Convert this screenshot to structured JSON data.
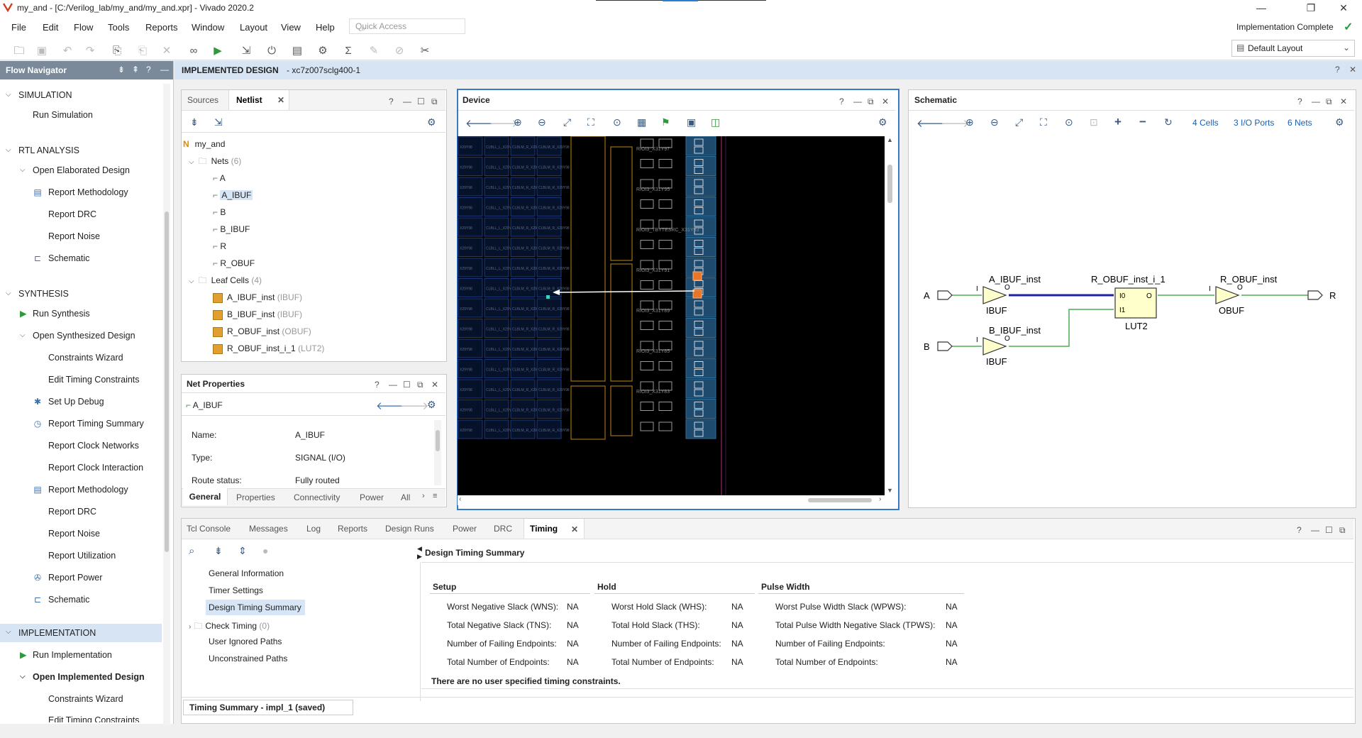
{
  "window": {
    "title": "my_and - [C:/Verilog_lab/my_and/my_and.xpr] - Vivado 2020.2",
    "status": "Implementation Complete",
    "layout_select": "Default Layout",
    "quick_access_placeholder": "Quick Access"
  },
  "menu": [
    "File",
    "Edit",
    "Flow",
    "Tools",
    "Reports",
    "Window",
    "Layout",
    "View",
    "Help"
  ],
  "flow_navigator": {
    "title": "Flow Navigator",
    "sections": [
      {
        "label": "SIMULATION"
      },
      {
        "label": "RTL ANALYSIS"
      },
      {
        "label": "SYNTHESIS"
      },
      {
        "label": "IMPLEMENTATION"
      }
    ],
    "items": {
      "run_simulation": "Run Simulation",
      "open_elaborated": "Open Elaborated Design",
      "rtl_report_methodology": "Report Methodology",
      "rtl_report_drc": "Report DRC",
      "rtl_report_noise": "Report Noise",
      "rtl_schematic": "Schematic",
      "run_synthesis": "Run Synthesis",
      "open_synthesized": "Open Synthesized Design",
      "syn_constraints_wizard": "Constraints Wizard",
      "syn_edit_timing": "Edit Timing Constraints",
      "syn_setup_debug": "Set Up Debug",
      "syn_report_timing": "Report Timing Summary",
      "syn_report_clock_networks": "Report Clock Networks",
      "syn_report_clock_interaction": "Report Clock Interaction",
      "syn_report_methodology": "Report Methodology",
      "syn_report_drc": "Report DRC",
      "syn_report_noise": "Report Noise",
      "syn_report_utilization": "Report Utilization",
      "syn_report_power": "Report Power",
      "syn_schematic": "Schematic",
      "run_implementation": "Run Implementation",
      "open_implemented": "Open Implemented Design",
      "impl_constraints_wizard": "Constraints Wizard",
      "impl_edit_timing": "Edit Timing Constraints"
    }
  },
  "header": {
    "title": "IMPLEMENTED DESIGN",
    "part": "- xc7z007sclg400-1"
  },
  "netlist_panel": {
    "tabs": [
      "Sources",
      "Netlist"
    ],
    "active_tab": "Netlist",
    "top": "my_and",
    "nets_label": "Nets",
    "nets_count": "(6)",
    "nets": [
      "A",
      "A_IBUF",
      "B",
      "B_IBUF",
      "R",
      "R_OBUF"
    ],
    "leaf_label": "Leaf Cells",
    "leaf_count": "(4)",
    "cells": [
      {
        "name": "A_IBUF_inst",
        "type": "(IBUF)"
      },
      {
        "name": "B_IBUF_inst",
        "type": "(IBUF)"
      },
      {
        "name": "R_OBUF_inst",
        "type": "(OBUF)"
      },
      {
        "name": "R_OBUF_inst_i_1",
        "type": "(LUT2)"
      }
    ]
  },
  "net_properties": {
    "title": "Net Properties",
    "net": "A_IBUF",
    "name_label": "Name:",
    "name_value": "A_IBUF",
    "type_label": "Type:",
    "type_value": "SIGNAL (I/O)",
    "route_label": "Route status:",
    "route_value": "Fully routed",
    "tabs": [
      "General",
      "Properties",
      "Connectivity",
      "Power",
      "All"
    ]
  },
  "device": {
    "title": "Device",
    "site_labels": [
      "RIOI3_X31Y97",
      "RIOI3_X31Y95",
      "RIOI3_TBYTESRC_X31Y93",
      "RIOI3_X31Y91",
      "RIOI3_X31Y89",
      "RIOI3_X31Y85",
      "RIOI3_X31Y83"
    ],
    "tiles": [
      "X29Y98",
      "CLBLL_L_X29Y98",
      "CLBLM_R_X29Y98"
    ]
  },
  "schematic": {
    "title": "Schematic",
    "cells_link": "4 Cells",
    "ports_link": "3 I/O Ports",
    "nets_link": "6 Nets",
    "ports": {
      "a": "A",
      "b": "B",
      "r": "R"
    },
    "a_ibuf_name": "A_IBUF_inst",
    "b_ibuf_name": "B_IBUF_inst",
    "lut_name": "R_OBUF_inst_i_1",
    "obuf_name": "R_OBUF_inst",
    "ibuf_type": "IBUF",
    "lut_type": "LUT2",
    "obuf_type": "OBUF",
    "pin_i": "I",
    "pin_o": "O",
    "pin_i0": "I0",
    "pin_i1": "I1"
  },
  "bottom_tabs": [
    "Tcl Console",
    "Messages",
    "Log",
    "Reports",
    "Design Runs",
    "Power",
    "DRC",
    "Timing"
  ],
  "bottom_active": "Timing",
  "timing_tree": [
    "General Information",
    "Timer Settings",
    "Design Timing Summary",
    "Check Timing",
    "User Ignored Paths",
    "Unconstrained Paths"
  ],
  "check_timing_count": "(0)",
  "timing_summary": {
    "title": "Design Timing Summary",
    "setup": {
      "head": "Setup",
      "rows": [
        {
          "label": "Worst Negative Slack (WNS):",
          "value": "NA"
        },
        {
          "label": "Total Negative Slack (TNS):",
          "value": "NA"
        },
        {
          "label": "Number of Failing Endpoints:",
          "value": "NA"
        },
        {
          "label": "Total Number of Endpoints:",
          "value": "NA"
        }
      ]
    },
    "hold": {
      "head": "Hold",
      "rows": [
        {
          "label": "Worst Hold Slack (WHS):",
          "value": "NA"
        },
        {
          "label": "Total Hold Slack (THS):",
          "value": "NA"
        },
        {
          "label": "Number of Failing Endpoints:",
          "value": "NA"
        },
        {
          "label": "Total Number of Endpoints:",
          "value": "NA"
        }
      ]
    },
    "pulse": {
      "head": "Pulse Width",
      "rows": [
        {
          "label": "Worst Pulse Width Slack (WPWS):",
          "value": "NA"
        },
        {
          "label": "Total Pulse Width Negative Slack (TPWS):",
          "value": "NA"
        },
        {
          "label": "Number of Failing Endpoints:",
          "value": "NA"
        },
        {
          "label": "Total Number of Endpoints:",
          "value": "NA"
        }
      ]
    },
    "note": "There are no user specified timing constraints."
  },
  "footer_tab": "Timing Summary - impl_1 (saved)",
  "colors": {
    "accent": "#1a5fb4",
    "net_selected": "#1e22a8",
    "net": "#4caf50",
    "cell": "#e0a030"
  }
}
